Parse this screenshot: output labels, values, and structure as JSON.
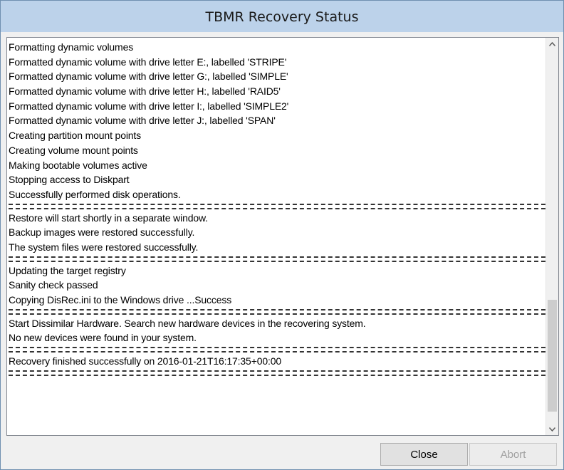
{
  "window": {
    "title": "TBMR Recovery Status"
  },
  "log": [
    {
      "type": "text",
      "text": "Formatting dynamic volumes"
    },
    {
      "type": "text",
      "text": "Formatted dynamic volume with drive letter E:, labelled 'STRIPE'"
    },
    {
      "type": "text",
      "text": "Formatted dynamic volume with drive letter G:, labelled 'SIMPLE'"
    },
    {
      "type": "text",
      "text": "Formatted dynamic volume with drive letter H:, labelled 'RAID5'"
    },
    {
      "type": "text",
      "text": "Formatted dynamic volume with drive letter I:, labelled 'SIMPLE2'"
    },
    {
      "type": "text",
      "text": "Formatted dynamic volume with drive letter J:, labelled 'SPAN'"
    },
    {
      "type": "text",
      "text": "Creating partition mount points"
    },
    {
      "type": "text",
      "text": "Creating volume mount points"
    },
    {
      "type": "text",
      "text": "Making bootable volumes active"
    },
    {
      "type": "text",
      "text": "Stopping access to Diskpart"
    },
    {
      "type": "text",
      "text": "Successfully performed disk operations."
    },
    {
      "type": "separator"
    },
    {
      "type": "text",
      "text": "Restore will start shortly in a separate window."
    },
    {
      "type": "text",
      "text": "Backup images were restored successfully."
    },
    {
      "type": "text",
      "text": "The system files were restored successfully."
    },
    {
      "type": "separator"
    },
    {
      "type": "text",
      "text": "Updating the target registry"
    },
    {
      "type": "text",
      "text": "Sanity check passed"
    },
    {
      "type": "text",
      "text": "Copying DisRec.ini to the Windows drive ...Success"
    },
    {
      "type": "separator"
    },
    {
      "type": "text",
      "text": "Start Dissimilar Hardware. Search new hardware devices in the recovering system."
    },
    {
      "type": "text",
      "text": "No new devices were found in your system."
    },
    {
      "type": "separator"
    },
    {
      "type": "text",
      "text": "Recovery finished successfully on 2016-01-21T16:17:35+00:00"
    },
    {
      "type": "separator"
    }
  ],
  "scrollbar": {
    "up_icon": "chevron-up-icon",
    "down_icon": "chevron-down-icon"
  },
  "buttons": {
    "close": "Close",
    "abort": "Abort"
  }
}
